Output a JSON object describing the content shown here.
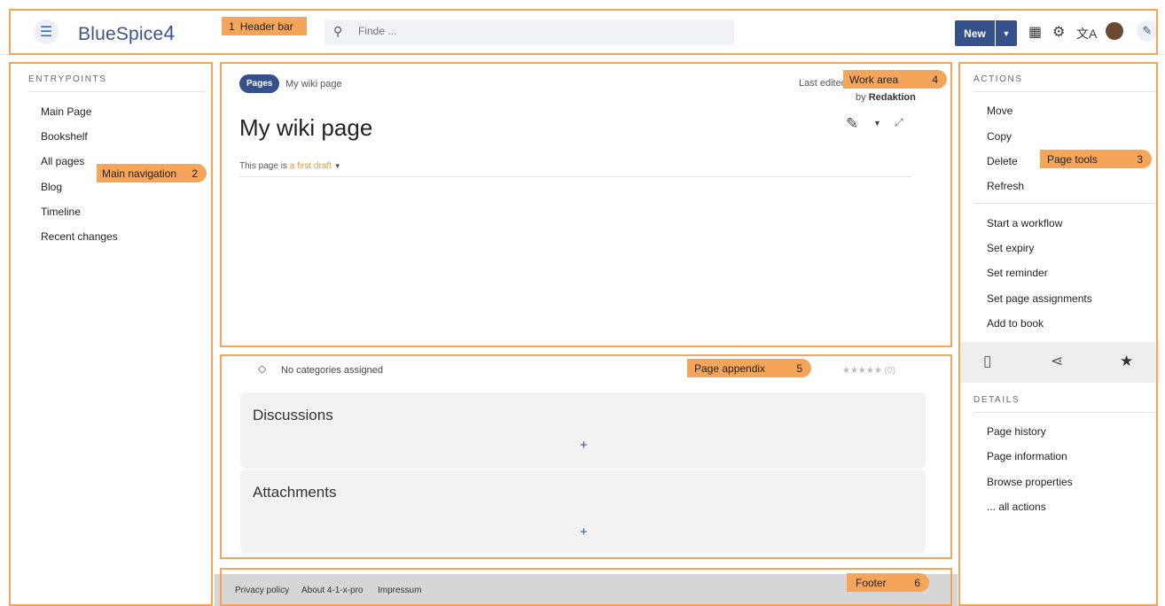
{
  "header": {
    "logo_text": "BlueSpice",
    "logo_version": "4",
    "search_placeholder": "Finde ...",
    "new_label": "New",
    "menu_icon": "hamburger-menu-icon",
    "grid_icon": "apps-grid-icon",
    "settings_icon": "gear-icon",
    "language_icon": "translate-icon",
    "user_icon": "user-avatar",
    "tools_icon": "wrench-icon"
  },
  "left_sidebar": {
    "title": "ENTRYPOINTS",
    "items": [
      "Main Page",
      "Bookshelf",
      "All pages",
      "Blog",
      "Timeline",
      "Recent changes"
    ]
  },
  "work_area": {
    "badge": "Pages",
    "breadcrumb": "My wiki page",
    "last_edited_prefix": "Last edited",
    "editor_prefix": "by",
    "editor_name": "Redaktion",
    "page_title": "My wiki page",
    "status_prefix": "This page is",
    "status_value": "a first draft"
  },
  "appendix": {
    "categories": "No categories assigned",
    "rating": "★★★★★ (0)",
    "discussions_title": "Discussions",
    "attachments_title": "Attachments",
    "add_symbol": "+"
  },
  "footer": {
    "links": [
      "Privacy policy",
      "About 4-1-x-pro",
      "Impressum"
    ]
  },
  "right_sidebar": {
    "actions_title": "ACTIONS",
    "actions_group1": [
      "Move",
      "Copy",
      "Delete",
      "Refresh"
    ],
    "actions_group2": [
      "Start a workflow",
      "Set expiry",
      "Set reminder",
      "Set page assignments",
      "Add to book"
    ],
    "details_title": "DETAILS",
    "details": [
      "Page history",
      "Page information",
      "Browse properties",
      "... all actions"
    ]
  },
  "callouts": {
    "header_bar": {
      "num": "1",
      "label": "Header bar"
    },
    "main_navigation": {
      "num": "2",
      "label": "Main navigation"
    },
    "page_tools": {
      "num": "3",
      "label": "Page tools"
    },
    "work_area": {
      "num": "4",
      "label": "Work area"
    },
    "page_appendix": {
      "num": "5",
      "label": "Page appendix"
    },
    "footer": {
      "num": "6",
      "label": "Footer"
    }
  },
  "colors": {
    "accent": "#36508c",
    "highlight": "#f5a55a",
    "draft_link": "#e39d2b"
  }
}
